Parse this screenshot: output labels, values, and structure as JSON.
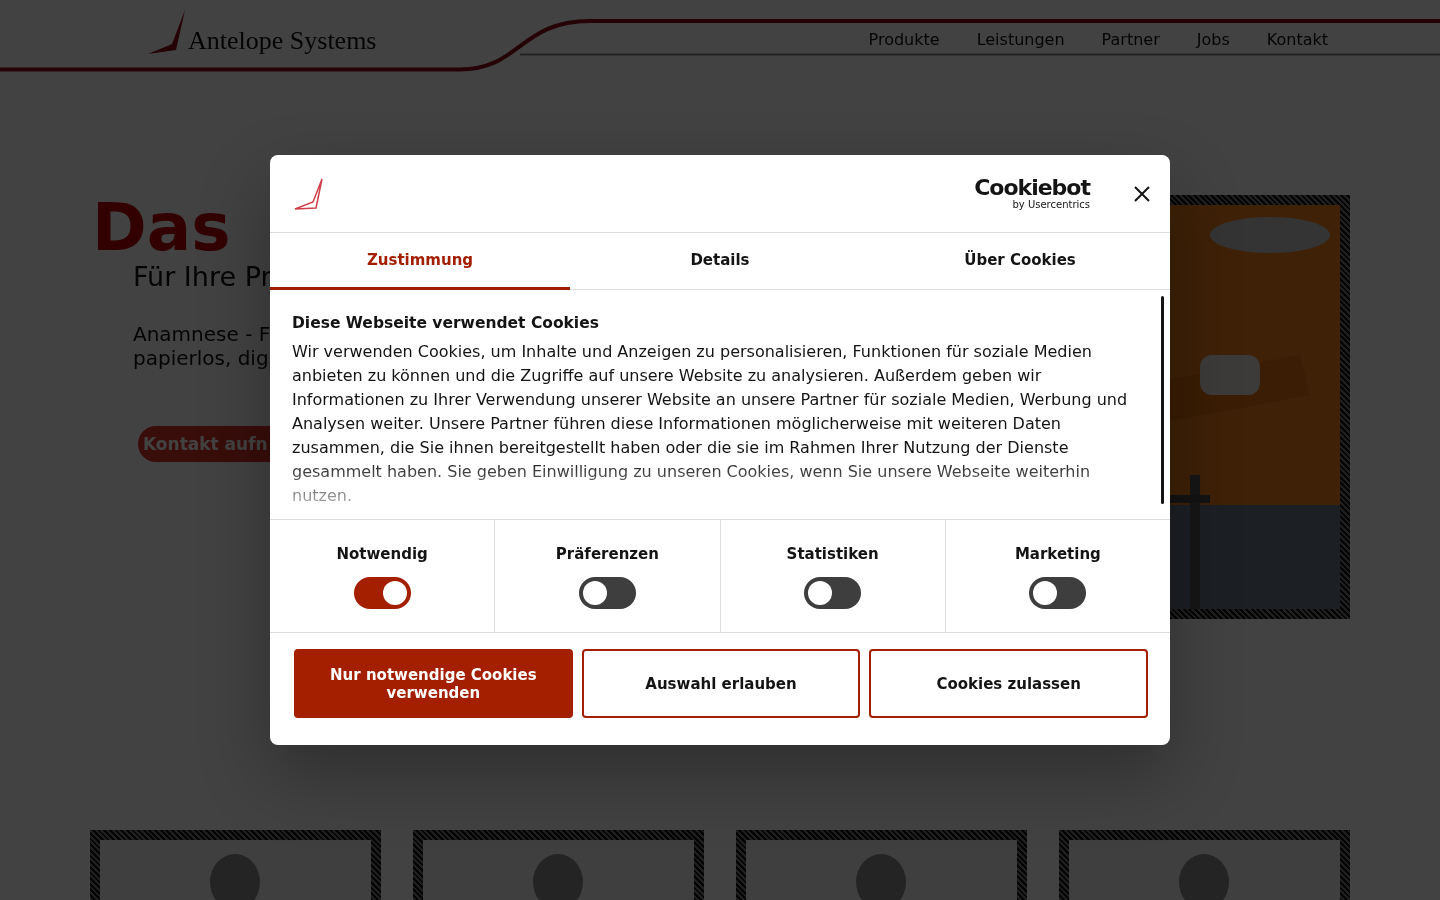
{
  "header": {
    "brand": "Antelope Systems",
    "nav": [
      {
        "label": "Produkte"
      },
      {
        "label": "Leistungen"
      },
      {
        "label": "Partner"
      },
      {
        "label": "Jobs"
      },
      {
        "label": "Kontakt"
      }
    ]
  },
  "hero": {
    "title": "Das",
    "subtitle": "Für Ihre Pr",
    "intro": [
      "Anamnese - F",
      "papierlos, dig"
    ],
    "cta": "Kontakt aufn",
    "photo": {
      "kind": "picture"
    }
  },
  "cards": [
    {
      "kind": "picture"
    },
    {
      "kind": "picture"
    },
    {
      "kind": "picture"
    },
    {
      "kind": "picture"
    }
  ],
  "dialog": {
    "brand": "Cookiebot",
    "brand_sub": "by Usercentrics",
    "tabs": [
      {
        "label": "Zustimmung",
        "selected": true
      },
      {
        "label": "Details",
        "selected": false
      },
      {
        "label": "Über Cookies",
        "selected": false
      }
    ],
    "heading": "Diese Webseite verwendet Cookies",
    "text": "Wir verwenden Cookies, um Inhalte und Anzeigen zu personalisieren, Funktionen für soziale Medien anbieten zu können und die Zugriffe auf unsere Website zu analysieren. Außerdem geben wir Informationen zu Ihrer Verwendung unserer Website an unsere Partner für soziale Medien, Werbung und Analysen weiter. Unsere Partner führen diese Informationen möglicherweise mit weiteren Daten zusammen, die Sie ihnen bereitgestellt haben oder die sie im Rahmen Ihrer Nutzung der Dienste gesammelt haben. Sie geben Einwilligung zu unseren Cookies, wenn Sie unsere Webseite weiterhin nutzen.",
    "categories": [
      {
        "label": "Notwendig",
        "on": true
      },
      {
        "label": "Präferenzen",
        "on": false
      },
      {
        "label": "Statistiken",
        "on": false
      },
      {
        "label": "Marketing",
        "on": false
      }
    ],
    "buttons": [
      {
        "label": "Nur notwendige Cookies verwenden",
        "kind": "primary"
      },
      {
        "label": "Auswahl erlauben",
        "kind": "outline"
      },
      {
        "label": "Cookies zulassen",
        "kind": "outline"
      }
    ]
  }
}
